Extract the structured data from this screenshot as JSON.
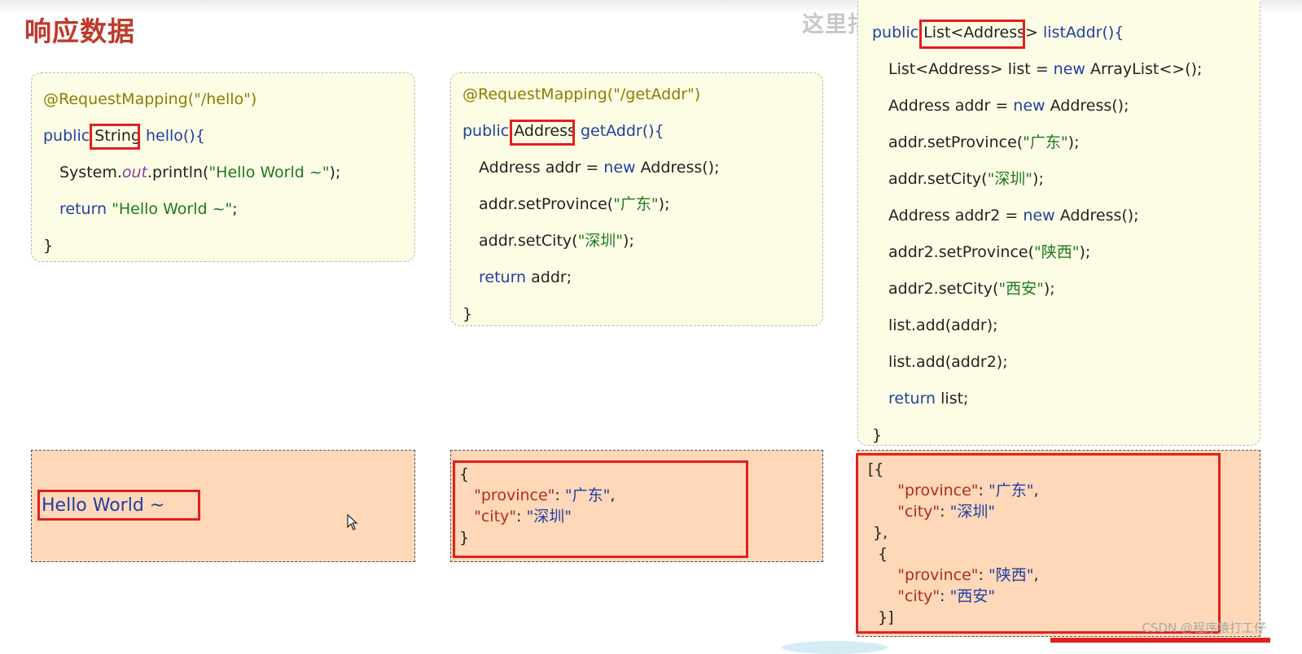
{
  "page": {
    "title": "响应数据",
    "subtitle_overlay": "这里指的是路径的接口",
    "watermark": "CSDN @程序猿打工仔"
  },
  "examples": [
    {
      "code": {
        "annotation": "@RequestMapping(\"/hello\")",
        "modifier": "public",
        "return_type": "String",
        "signature": "hello(){",
        "body": [
          "System.out.println(\"Hello World ~\");",
          "return \"Hello World ~\";"
        ],
        "closing": "}"
      },
      "response": "Hello World ~"
    },
    {
      "code": {
        "annotation": "@RequestMapping(\"/getAddr\")",
        "modifier": "public",
        "return_type": "Address",
        "signature": "getAddr(){",
        "body": [
          "Address addr = new Address();",
          "addr.setProvince(\"广东\");",
          "addr.setCity(\"深圳\");",
          "return addr;"
        ],
        "closing": "}"
      },
      "response": {
        "open": "{",
        "province_key": "\"province\"",
        "province_val": "\"广东\"",
        "city_key": "\"city\"",
        "city_val": "\"深圳\"",
        "close": "}"
      }
    },
    {
      "code": {
        "modifier": "public",
        "return_type": "List<Address>",
        "signature": "listAddr(){",
        "body": [
          "List<Address> list = new ArrayList<>();",
          "Address addr = new Address();",
          "addr.setProvince(\"广东\");",
          "addr.setCity(\"深圳\");",
          "Address addr2 = new Address();",
          "addr2.setProvince(\"陕西\");",
          "addr2.setCity(\"西安\");",
          "list.add(addr);",
          "list.add(addr2);",
          "return list;"
        ],
        "closing": "}"
      },
      "response": {
        "open": "[{",
        "item1_province_key": "\"province\"",
        "item1_province_val": "\"广东\"",
        "item1_city_key": "\"city\"",
        "item1_city_val": "\"深圳\"",
        "item_sep": "},",
        "item2_open": "{",
        "item2_province_key": "\"province\"",
        "item2_province_val": "\"陕西\"",
        "item2_city_key": "\"city\"",
        "item2_city_val": "\"西安\"",
        "close": "}]"
      }
    }
  ],
  "colors": {
    "title": "#c0392b",
    "code_bg": "#fdfde5",
    "response_bg": "#fed8b8",
    "highlight_border": "#e02020",
    "keyword": "#1f3fa3",
    "string": "#1e7a1e",
    "annotation": "#8b7d00"
  }
}
